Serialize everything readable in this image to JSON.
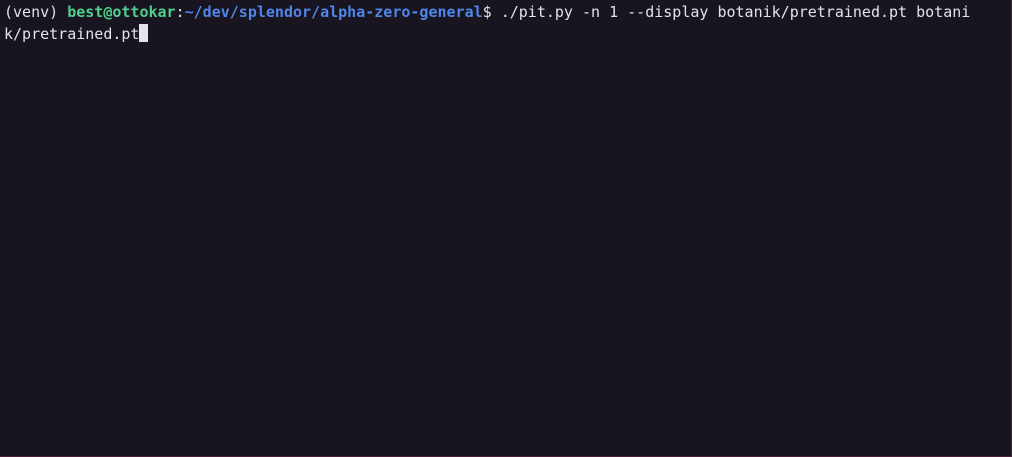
{
  "terminal": {
    "prompt": {
      "venv": "(venv) ",
      "user_host": "best@ottokar",
      "separator": ":",
      "cwd": "~/dev/splendor/alpha-zero-general",
      "symbol": "$ "
    },
    "command_line_1": "./pit.py -n 1 --display botanik/pretrained.pt botani",
    "command_line_2": "k/pretrained.pt"
  },
  "colors": {
    "background": "#181520",
    "foreground": "#e4e2ea",
    "user_host": "#4fd18b",
    "path": "#4f86e8",
    "cursor": "#e6e4ea"
  }
}
